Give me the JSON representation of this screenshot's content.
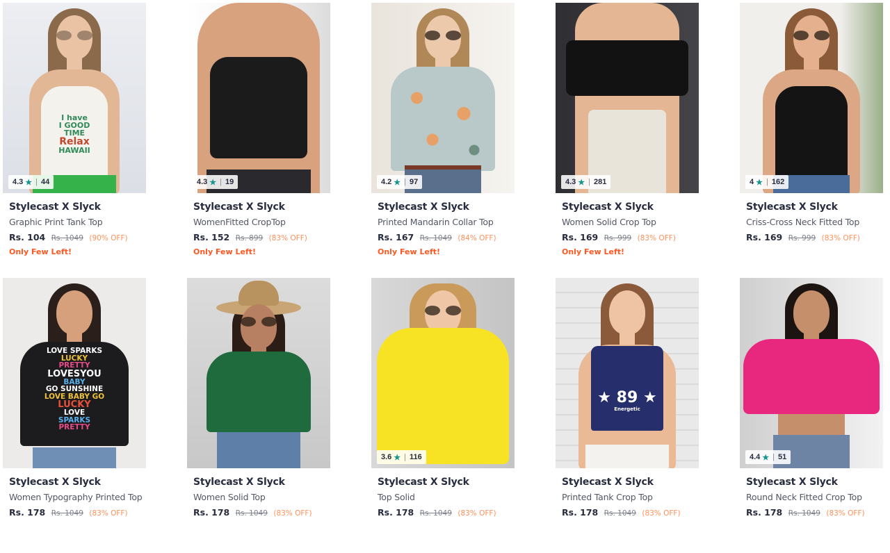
{
  "colors": {
    "brand_text": "#282c3f",
    "name_text": "#535766",
    "mrp_text": "#7e818c",
    "discount_text": "#ff905a",
    "few_left_text": "#ff5722",
    "rating_star": "#14958f"
  },
  "products": [
    {
      "brand": "Stylecast X Slyck",
      "name": "Graphic Print Tank Top",
      "price": "Rs. 104",
      "mrp": "Rs. 1049",
      "discount": "(90% OFF)",
      "stock_note": "Only Few Left!",
      "rating": {
        "score": "4.3",
        "count": "44",
        "star_icon": "star-icon"
      },
      "image": {
        "print_lines": [
          "I have",
          "I GOOD",
          "TIME",
          "Relax",
          "HAWAII"
        ]
      }
    },
    {
      "brand": "Stylecast X Slyck",
      "name": "WomenFitted CropTop",
      "price": "Rs. 152",
      "mrp": "Rs. 899",
      "discount": "(83% OFF)",
      "stock_note": "Only Few Left!",
      "rating": {
        "score": "4.3",
        "count": "19",
        "star_icon": "star-icon"
      },
      "image": {}
    },
    {
      "brand": "Stylecast X Slyck",
      "name": "Printed Mandarin Collar Top",
      "price": "Rs. 167",
      "mrp": "Rs. 1049",
      "discount": "(84% OFF)",
      "stock_note": "Only Few Left!",
      "rating": {
        "score": "4.2",
        "count": "97",
        "star_icon": "star-icon"
      },
      "image": {}
    },
    {
      "brand": "Stylecast X Slyck",
      "name": "Women Solid Crop Top",
      "price": "Rs. 169",
      "mrp": "Rs. 999",
      "discount": "(83% OFF)",
      "stock_note": "Only Few Left!",
      "rating": {
        "score": "4.3",
        "count": "281",
        "star_icon": "star-icon"
      },
      "image": {}
    },
    {
      "brand": "Stylecast X Slyck",
      "name": "Criss-Cross Neck Fitted Top",
      "price": "Rs. 169",
      "mrp": "Rs. 999",
      "discount": "(83% OFF)",
      "stock_note": "",
      "rating": {
        "score": "4",
        "count": "162",
        "star_icon": "star-icon"
      },
      "image": {}
    },
    {
      "brand": "Stylecast X Slyck",
      "name": "Women Typography Printed Top",
      "price": "Rs. 178",
      "mrp": "Rs. 1049",
      "discount": "(83% OFF)",
      "stock_note": "",
      "rating": null,
      "image": {
        "print_lines": [
          "LOVE SPARKS",
          "LUCKY",
          "PRETTY",
          "LOVESYOU",
          "BABY",
          "GO SUNSHINE",
          "LOVE BABY GO",
          "LUCKY",
          "LOVE",
          "SPARKS",
          "PRETTY"
        ]
      }
    },
    {
      "brand": "Stylecast X Slyck",
      "name": "Women Solid Top",
      "price": "Rs. 178",
      "mrp": "Rs. 1049",
      "discount": "(83% OFF)",
      "stock_note": "",
      "rating": null,
      "image": {}
    },
    {
      "brand": "Stylecast X Slyck",
      "name": "Top Solid",
      "price": "Rs. 178",
      "mrp": "Rs. 1049",
      "discount": "(83% OFF)",
      "stock_note": "",
      "rating": {
        "score": "3.6",
        "count": "116",
        "star_icon": "star-icon"
      },
      "image": {}
    },
    {
      "brand": "Stylecast X Slyck",
      "name": "Printed Tank Crop Top",
      "price": "Rs. 178",
      "mrp": "Rs. 1049",
      "discount": "(83% OFF)",
      "stock_note": "",
      "rating": null,
      "image": {
        "print_lines": [
          "★ 89 ★",
          "Energetic"
        ]
      }
    },
    {
      "brand": "Stylecast X Slyck",
      "name": "Round Neck Fitted Crop Top",
      "price": "Rs. 178",
      "mrp": "Rs. 1049",
      "discount": "(83% OFF)",
      "stock_note": "",
      "rating": {
        "score": "4.4",
        "count": "51",
        "star_icon": "star-icon"
      },
      "image": {}
    }
  ]
}
